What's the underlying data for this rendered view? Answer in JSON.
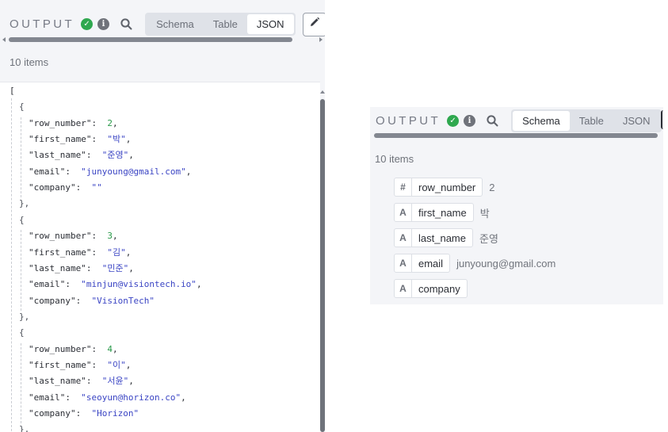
{
  "left": {
    "output_label": "OUTPUT",
    "tabs": [
      "Schema",
      "Table",
      "JSON"
    ],
    "active_tab": "JSON",
    "items_count": "10 items",
    "json_lines": [
      {
        "t": "br",
        "text": "["
      },
      {
        "t": "br",
        "text": "{"
      },
      {
        "t": "kv",
        "key": "\"row_number\"",
        "val": "2",
        "vt": "n"
      },
      {
        "t": "kv",
        "key": "\"first_name\"",
        "val": "\"박\"",
        "vt": "s"
      },
      {
        "t": "kv",
        "key": "\"last_name\"",
        "val": "\"준영\"",
        "vt": "s"
      },
      {
        "t": "kv",
        "key": "\"email\"",
        "val": "\"junyoung@gmail.com\"",
        "vt": "s"
      },
      {
        "t": "kv",
        "key": "\"company\"",
        "val": "\"\"",
        "vt": "s",
        "last": true
      },
      {
        "t": "br",
        "text": "},"
      },
      {
        "t": "br",
        "text": "{"
      },
      {
        "t": "kv",
        "key": "\"row_number\"",
        "val": "3",
        "vt": "n"
      },
      {
        "t": "kv",
        "key": "\"first_name\"",
        "val": "\"김\"",
        "vt": "s"
      },
      {
        "t": "kv",
        "key": "\"last_name\"",
        "val": "\"민준\"",
        "vt": "s"
      },
      {
        "t": "kv",
        "key": "\"email\"",
        "val": "\"minjun@visiontech.io\"",
        "vt": "s"
      },
      {
        "t": "kv",
        "key": "\"company\"",
        "val": "\"VisionTech\"",
        "vt": "s",
        "last": true
      },
      {
        "t": "br",
        "text": "},"
      },
      {
        "t": "br",
        "text": "{"
      },
      {
        "t": "kv",
        "key": "\"row_number\"",
        "val": "4",
        "vt": "n"
      },
      {
        "t": "kv",
        "key": "\"first_name\"",
        "val": "\"이\"",
        "vt": "s"
      },
      {
        "t": "kv",
        "key": "\"last_name\"",
        "val": "\"서윤\"",
        "vt": "s"
      },
      {
        "t": "kv",
        "key": "\"email\"",
        "val": "\"seoyun@horizon.co\"",
        "vt": "s"
      },
      {
        "t": "kv",
        "key": "\"company\"",
        "val": "\"Horizon\"",
        "vt": "s",
        "last": true
      },
      {
        "t": "br",
        "text": "},"
      }
    ]
  },
  "right": {
    "output_label": "OUTPUT",
    "tabs": [
      "Schema",
      "Table",
      "JSON"
    ],
    "active_tab": "Schema",
    "items_count": "10 items",
    "fields": [
      {
        "type_icon": "#",
        "name": "row_number",
        "value": "2"
      },
      {
        "type_icon": "A",
        "name": "first_name",
        "value": "박"
      },
      {
        "type_icon": "A",
        "name": "last_name",
        "value": "준영"
      },
      {
        "type_icon": "A",
        "name": "email",
        "value": "junyoung@gmail.com"
      },
      {
        "type_icon": "A",
        "name": "company",
        "value": ""
      }
    ]
  },
  "icons": {
    "status": "check-circle-icon",
    "info": "info-icon",
    "search": "search-icon",
    "edit": "pencil-icon"
  },
  "colors": {
    "success": "#2fa84f",
    "json_string": "#3b45c4",
    "json_number": "#2a9a4a",
    "panel_bg": "#f4f5f8"
  }
}
